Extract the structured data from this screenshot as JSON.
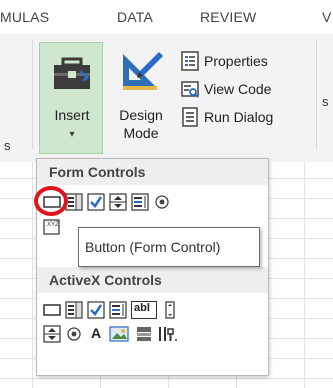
{
  "ribbon_tabs": [
    "MULAS",
    "DATA",
    "REVIEW",
    "V"
  ],
  "ribbon_left_fragment": "s",
  "insert_button": {
    "label": "Insert",
    "caret": "▾"
  },
  "design_mode_button": {
    "line1": "Design",
    "line2": "Mode"
  },
  "commands": {
    "properties": "Properties",
    "view_code": "View Code",
    "run_dialog": "Run Dialog"
  },
  "dropdown": {
    "form_controls_header": "Form Controls",
    "activex_controls_header": "ActiveX Controls",
    "activex_text_icon": "abl",
    "activex_label_icon": "A"
  },
  "tooltip_text": "Button (Form Control)",
  "colors": {
    "insert_highlight": "#cfe6cf",
    "highlight_ring": "#e0141b",
    "checkbox_blue": "#2b6ac9"
  }
}
